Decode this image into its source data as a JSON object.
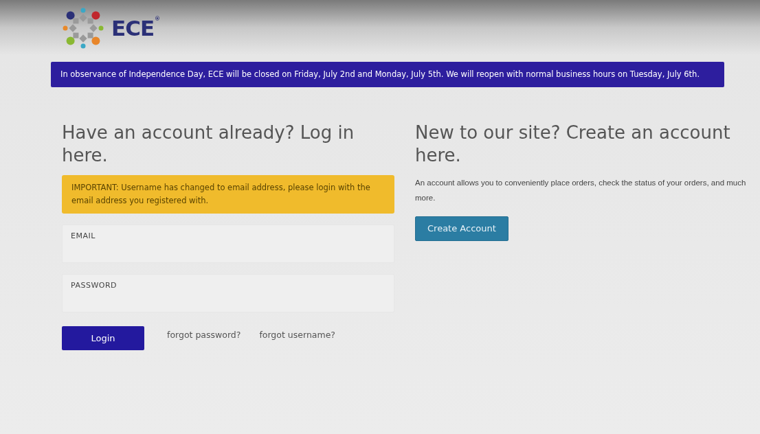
{
  "logo": {
    "text": "ECE",
    "mark": "®"
  },
  "notice": "In observance of Independence Day, ECE will be closed on Friday, July 2nd and Monday, July 5th. We will reopen with normal business hours on Tuesday, July 6th.",
  "login": {
    "heading": "Have an account already? Log in here.",
    "alert": "IMPORTANT: Username has changed to email address, please login with the email address you registered with.",
    "fields": [
      {
        "placeholder": "EMAIL"
      },
      {
        "placeholder": "PASSWORD"
      }
    ],
    "button": "Login",
    "links": [
      "forgot password?",
      "forgot username?"
    ]
  },
  "signup": {
    "heading": "New to our site? Create an account here.",
    "text": "An account allows you to conveniently place orders, check the status of your orders, and much more.",
    "button": "Create Account"
  }
}
